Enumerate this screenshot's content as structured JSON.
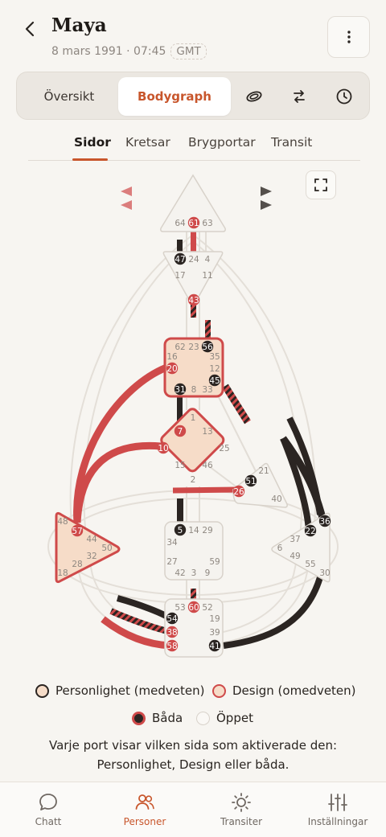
{
  "header": {
    "title": "Maya",
    "date": "8 mars 1991 · 07:45",
    "timezone": "GMT"
  },
  "segment_tabs": [
    {
      "label": "Översikt",
      "active": false
    },
    {
      "label": "Bodygraph",
      "active": true
    }
  ],
  "segment_icons": [
    "rings-icon",
    "swap-arrows-icon",
    "clock-icon"
  ],
  "sub_tabs": [
    {
      "label": "Sidor",
      "active": true
    },
    {
      "label": "Kretsar",
      "active": false
    },
    {
      "label": "Brygportar",
      "active": false
    },
    {
      "label": "Transit",
      "active": false
    }
  ],
  "colors": {
    "accent": "#c8562c",
    "design": "#cf4a4a",
    "personality": "#2b2522",
    "center_fill": "#f6dcc8"
  },
  "bodygraph": {
    "centers": [
      {
        "name": "head",
        "defined": false,
        "gates": [
          "64",
          "61",
          "63"
        ]
      },
      {
        "name": "ajna",
        "defined": false,
        "gates": [
          "47",
          "24",
          "4",
          "17",
          "11",
          "43"
        ]
      },
      {
        "name": "throat",
        "defined": true,
        "gates": [
          "62",
          "23",
          "56",
          "16",
          "35",
          "20",
          "12",
          "45",
          "31",
          "8",
          "33"
        ]
      },
      {
        "name": "g",
        "defined": true,
        "gates": [
          "1",
          "7",
          "13",
          "10",
          "25",
          "15",
          "46",
          "2"
        ]
      },
      {
        "name": "heart",
        "defined": false,
        "gates": [
          "21",
          "51",
          "26",
          "40"
        ]
      },
      {
        "name": "spleen",
        "defined": true,
        "gates": [
          "48",
          "57",
          "44",
          "50",
          "32",
          "28",
          "18"
        ]
      },
      {
        "name": "sacral",
        "defined": false,
        "gates": [
          "5",
          "14",
          "29",
          "34",
          "27",
          "59",
          "42",
          "3",
          "9"
        ]
      },
      {
        "name": "solar-plexus",
        "defined": false,
        "gates": [
          "36",
          "37",
          "22",
          "6",
          "49",
          "55",
          "30"
        ]
      },
      {
        "name": "root",
        "defined": false,
        "gates": [
          "53",
          "60",
          "52",
          "54",
          "19",
          "38",
          "39",
          "58",
          "41"
        ]
      }
    ],
    "activated_gates": {
      "design": [
        "61",
        "43",
        "20",
        "7",
        "10",
        "26",
        "57",
        "60",
        "38",
        "58"
      ],
      "personality": [
        "47",
        "56",
        "45",
        "31",
        "51",
        "5",
        "22",
        "36",
        "54",
        "41"
      ]
    }
  },
  "legend": {
    "personality": "Personlighet (medveten)",
    "design": "Design (omedveten)",
    "both": "Båda",
    "open": "Öppet"
  },
  "note": "Varje port visar vilken sida som aktiverade den: Personlighet, Design eller båda.",
  "nav": [
    {
      "label": "Chatt",
      "icon": "chat-icon",
      "active": false
    },
    {
      "label": "Personer",
      "icon": "people-icon",
      "active": true
    },
    {
      "label": "Transiter",
      "icon": "sun-icon",
      "active": false
    },
    {
      "label": "Inställningar",
      "icon": "sliders-icon",
      "active": false
    }
  ]
}
